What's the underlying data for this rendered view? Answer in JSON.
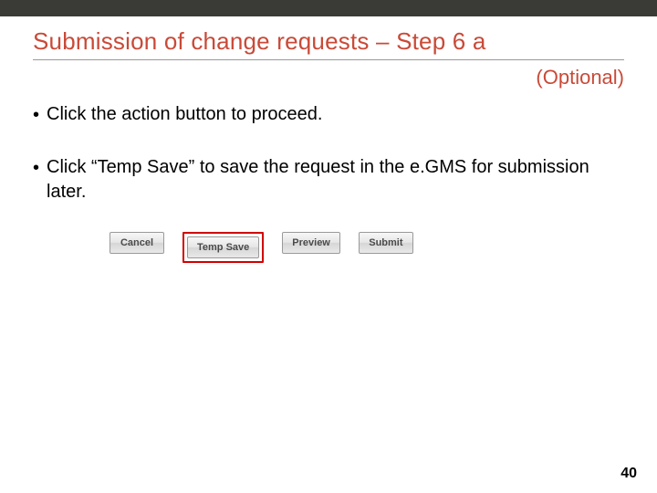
{
  "title": "Submission of change requests – Step 6 a",
  "optional_label": "(Optional)",
  "bullets": {
    "item1": "Click the action button to proceed.",
    "item2": "Click “Temp Save” to save the request in the e.GMS for submission later."
  },
  "buttons": {
    "cancel": "Cancel",
    "temp_save": "Temp Save",
    "preview": "Preview",
    "submit": "Submit"
  },
  "page_number": "40"
}
